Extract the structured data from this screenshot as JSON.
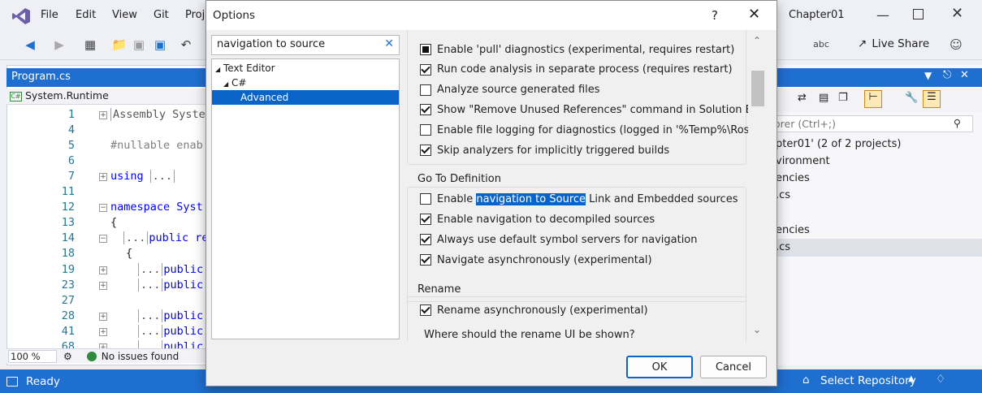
{
  "vs": {
    "menu": [
      "File",
      "Edit",
      "View",
      "Git",
      "Proj"
    ],
    "solution_name": "Chapter01",
    "live_share": "Live Share",
    "doc_tab": "Program.cs",
    "nav_scope": "System.Runtime",
    "code_lines": [
      {
        "n": "1",
        "text": "Assembly Syste"
      },
      {
        "n": "4",
        "text": ""
      },
      {
        "n": "5",
        "text": "#nullable enab"
      },
      {
        "n": "6",
        "text": ""
      },
      {
        "n": "7",
        "text": "using"
      },
      {
        "n": "11",
        "text": ""
      },
      {
        "n": "12",
        "text": "namespace Syst"
      },
      {
        "n": "13",
        "text": "{"
      },
      {
        "n": "14",
        "text": "public re"
      },
      {
        "n": "18",
        "text": "{"
      },
      {
        "n": "19",
        "text": "public"
      },
      {
        "n": "23",
        "text": "public"
      },
      {
        "n": "27",
        "text": ""
      },
      {
        "n": "28",
        "text": "public"
      },
      {
        "n": "41",
        "text": "public"
      },
      {
        "n": "68",
        "text": "public"
      }
    ],
    "zoom": "100 %",
    "issues": "No issues found",
    "status_ready": "Ready",
    "select_repo": "Select Repository",
    "sol_search_placeholder": "orer (Ctrl+;)",
    "sol_items": [
      "pter01' (2 of 2 projects)",
      "vironment",
      "encies",
      ".cs",
      "encies",
      ".cs"
    ]
  },
  "dialog": {
    "title": "Options",
    "help": "?",
    "search_value": "navigation to source",
    "tree": [
      {
        "label": "Text Editor",
        "level": 0
      },
      {
        "label": "C#",
        "level": 1
      },
      {
        "label": "Advanced",
        "level": 2,
        "selected": true
      }
    ],
    "group1_options": [
      {
        "label": "Enable 'pull' diagnostics (experimental, requires restart)",
        "state": "indeterminate"
      },
      {
        "label": "Run code analysis in separate process (requires restart)",
        "state": "checked"
      },
      {
        "label": "Analyze source generated files",
        "state": "unchecked"
      },
      {
        "label": "Show \"Remove Unused References\" command in Solution Exp",
        "state": "checked"
      },
      {
        "label": "Enable file logging for diagnostics (logged in '%Temp%\\Roslyı",
        "state": "unchecked"
      },
      {
        "label": "Skip analyzers for implicitly triggered builds",
        "state": "checked"
      }
    ],
    "goto_title": "Go To Definition",
    "goto_first": {
      "pre": "Enable ",
      "highlight": "navigation to Source",
      "post": " Link and Embedded sources",
      "state": "unchecked"
    },
    "goto_options": [
      {
        "label": "Enable navigation to decompiled sources",
        "state": "checked"
      },
      {
        "label": "Always use default symbol servers for navigation",
        "state": "checked"
      },
      {
        "label": "Navigate asynchronously (experimental)",
        "state": "checked"
      }
    ],
    "rename_title": "Rename",
    "rename_option": {
      "label": "Rename asynchronously (experimental)",
      "state": "checked"
    },
    "rename_question": "Where should the rename UI be shown?",
    "ok": "OK",
    "cancel": "Cancel"
  }
}
